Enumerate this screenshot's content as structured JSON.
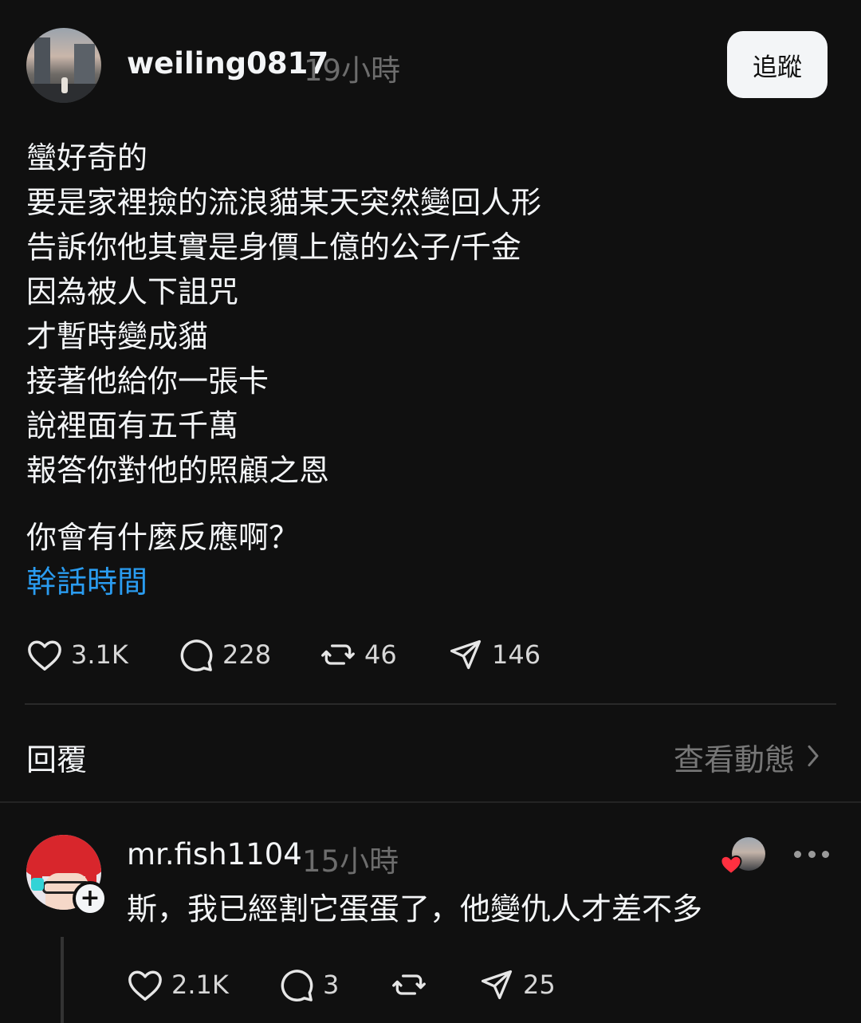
{
  "post": {
    "username": "weiling0817",
    "time": "19小時",
    "follow_label": "追蹤",
    "lines": [
      "蠻好奇的",
      "要是家裡撿的流浪貓某天突然變回人形",
      "告訴你他其實是身價上億的公子/千金",
      "因為被人下詛咒",
      "才暫時變成貓",
      "接著他給你一張卡",
      "說裡面有五千萬",
      "報答你對他的照顧之恩"
    ],
    "question": "你會有什麼反應啊？",
    "topic": "幹話時間",
    "stats": {
      "likes": "3.1K",
      "comments": "228",
      "reposts": "46",
      "shares": "146"
    }
  },
  "replies_section": {
    "label": "回覆",
    "view_activity": "查看動態"
  },
  "reply": {
    "username": "mr.fish1104",
    "time": "15小時",
    "text": "斯，我已經割它蛋蛋了，他變仇人才差不多",
    "stats": {
      "likes": "2.1K",
      "comments": "3",
      "shares": "25"
    }
  },
  "icons": {
    "like": "heart-icon",
    "comment": "comment-bubble-icon",
    "repost": "repost-icon",
    "share": "send-icon",
    "chevron": "chevron-right-icon",
    "more": "more-icon",
    "liked_badge": "heart-badge-icon"
  },
  "colors": {
    "background": "#101010",
    "text": "#f3f5f7",
    "muted": "#6d6d6d",
    "link": "#2a9cf0",
    "like_red": "#ff3040"
  }
}
